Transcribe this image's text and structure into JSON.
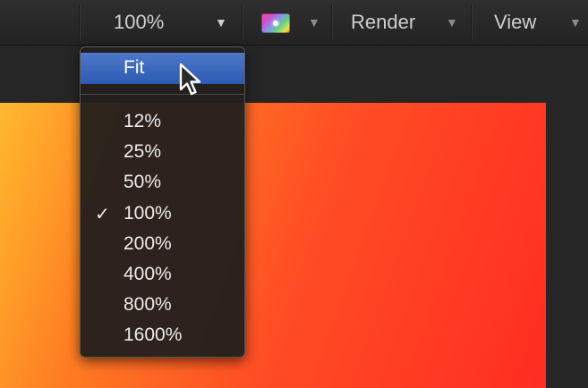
{
  "toolbar": {
    "zoom_value": "100%",
    "render_label": "Render",
    "view_label": "View",
    "dropdown_arrow": "▼"
  },
  "zoom_menu": {
    "fit_label": "Fit",
    "items": [
      {
        "label": "12%",
        "checked": false
      },
      {
        "label": "25%",
        "checked": false
      },
      {
        "label": "50%",
        "checked": false
      },
      {
        "label": "100%",
        "checked": true
      },
      {
        "label": "200%",
        "checked": false
      },
      {
        "label": "400%",
        "checked": false
      },
      {
        "label": "800%",
        "checked": false
      },
      {
        "label": "1600%",
        "checked": false
      }
    ],
    "check_mark": "✓"
  },
  "icons": {
    "color_channels": "color-channels-icon",
    "cursor": "arrow-cursor-icon"
  },
  "colors": {
    "highlight": "#3a66bd",
    "canvas_start": "#ffb92e",
    "canvas_end": "#ff2d22"
  }
}
